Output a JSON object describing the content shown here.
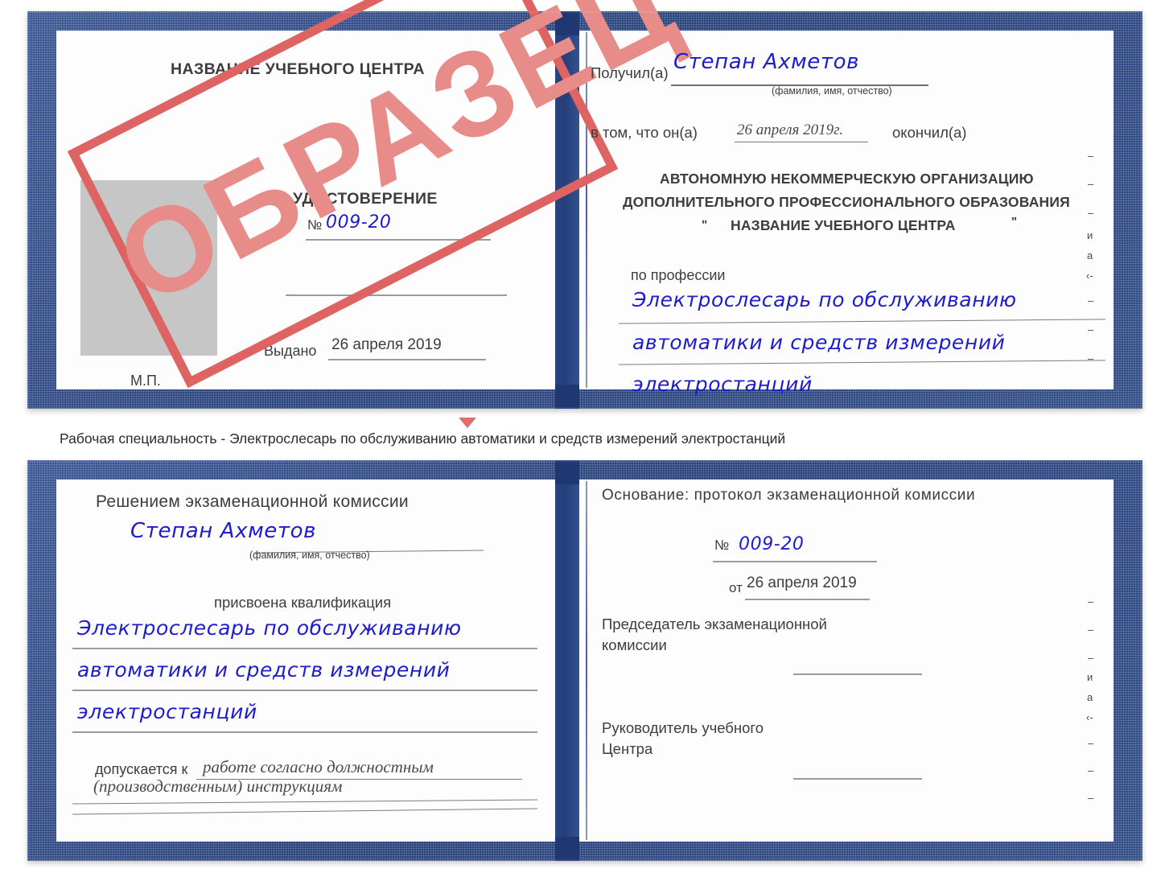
{
  "document": {
    "type": "certificate-scan",
    "colors": {
      "cover_blue": "#2f4b86",
      "handwriting_blue": "#1c1ccd",
      "stamp_red": "#de6463",
      "stamp_fill": "#e88c8a",
      "page_white": "#fdfdfd",
      "rule_gray": "#9b9b9b",
      "photo_placeholder_gray": "#c6c6c6"
    }
  },
  "stamp": {
    "label": "ОБРАЗЕЦ"
  },
  "top_certificate": {
    "left_page": {
      "header": "НАЗВАНИЕ УЧЕБНОГО ЦЕНТРА",
      "title": "УДОСТОВЕРЕНИЕ",
      "number_label": "№",
      "number_value": "009-20",
      "issued_label": "Выдано",
      "issued_value": "26 апреля 2019",
      "seal_label": "М.П."
    },
    "right_page": {
      "received_label": "Получил(а)",
      "received_value": "Степан Ахметов",
      "name_hint": "(фамилия, имя, отчество)",
      "in_that_label": "в том, что он(а)",
      "in_that_value": "26 апреля 2019г.",
      "finished_label": "окончил(а)",
      "organization_line1": "АВТОНОМНУЮ НЕКОММЕРЧЕСКУЮ ОРГАНИЗАЦИЮ",
      "organization_line2": "ДОПОЛНИТЕЛЬНОГО ПРОФЕССИОНАЛЬНОГО ОБРАЗОВАНИЯ",
      "organization_quote_open": "\"",
      "organization_line3": "НАЗВАНИЕ УЧЕБНОГО ЦЕНТРА",
      "organization_quote_close": "\"",
      "profession_label": "по профессии",
      "profession_line1": "Электрослесарь по обслуживанию",
      "profession_line2": "автоматики и средств измерений",
      "profession_line3": "электростанций",
      "edge_glyphs": [
        "–",
        "–",
        "–",
        "и",
        "а",
        "‹-",
        "–",
        "–",
        "–"
      ]
    }
  },
  "caption": {
    "text": "Рабочая специальность - Электрослесарь по обслуживанию автоматики и средств измерений электростанций"
  },
  "bottom_certificate": {
    "left_page": {
      "heading": "Решением экзаменационной комиссии",
      "name_value": "Степан Ахметов",
      "name_hint": "(фамилия, имя, отчество)",
      "qualification_label": "присвоена квалификация",
      "qualification_line1": "Электрослесарь по обслуживанию",
      "qualification_line2": "автоматики и средств измерений",
      "qualification_line3": "электростанций",
      "admitted_label": "допускается к",
      "admitted_value_line1": "работе согласно должностным",
      "admitted_value_line2": "(производственным) инструкциям"
    },
    "right_page": {
      "basis_label": "Основание: протокол экзаменационной комиссии",
      "protocol_number_label": "№",
      "protocol_number_value": "009-20",
      "protocol_date_label": "от",
      "protocol_date_value": "26 апреля 2019",
      "chairman_line1": "Председатель экзаменационной",
      "chairman_line2": "комиссии",
      "head_line1": "Руководитель учебного",
      "head_line2": "Центра",
      "edge_glyphs": [
        "–",
        "–",
        "–",
        "и",
        "а",
        "‹-",
        "–",
        "–",
        "–"
      ]
    }
  }
}
